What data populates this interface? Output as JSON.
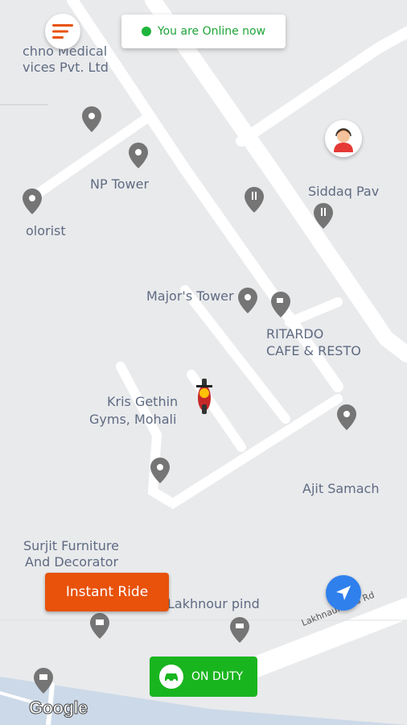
{
  "status": {
    "text": "You are Online now",
    "color": "#1fb53c"
  },
  "menu": {
    "icon": "hamburger-menu-icon"
  },
  "support": {
    "icon": "support-agent-avatar-icon"
  },
  "map": {
    "labels": {
      "techno_1": "chno Medical",
      "techno_2": "vices Pvt. Ltd",
      "np_tower": "NP Tower",
      "florist": "olorist",
      "siddaq": "Siddaq Pav",
      "majors_tower": "Major's Tower",
      "ritardo_1": "RITARDO",
      "ritardo_2": "CAFE & RESTO",
      "kris_1": "Kris Gethin",
      "kris_2": "Gyms, Mohali",
      "ajit": "Ajit Samach",
      "surjit_1": "Surjit Furniture",
      "surjit_2": "And Decorator",
      "lakhnour_pind": "Lakhnour pind",
      "road": "Lakhnaur Pind Rd"
    },
    "attribution": "Google"
  },
  "buttons": {
    "instant_ride": "Instant Ride",
    "on_duty": "ON DUTY",
    "locate": "navigation-arrow-icon"
  },
  "colors": {
    "accent_orange": "#e8520b",
    "duty_green": "#19b51f",
    "locate_blue": "#2f80ed"
  }
}
